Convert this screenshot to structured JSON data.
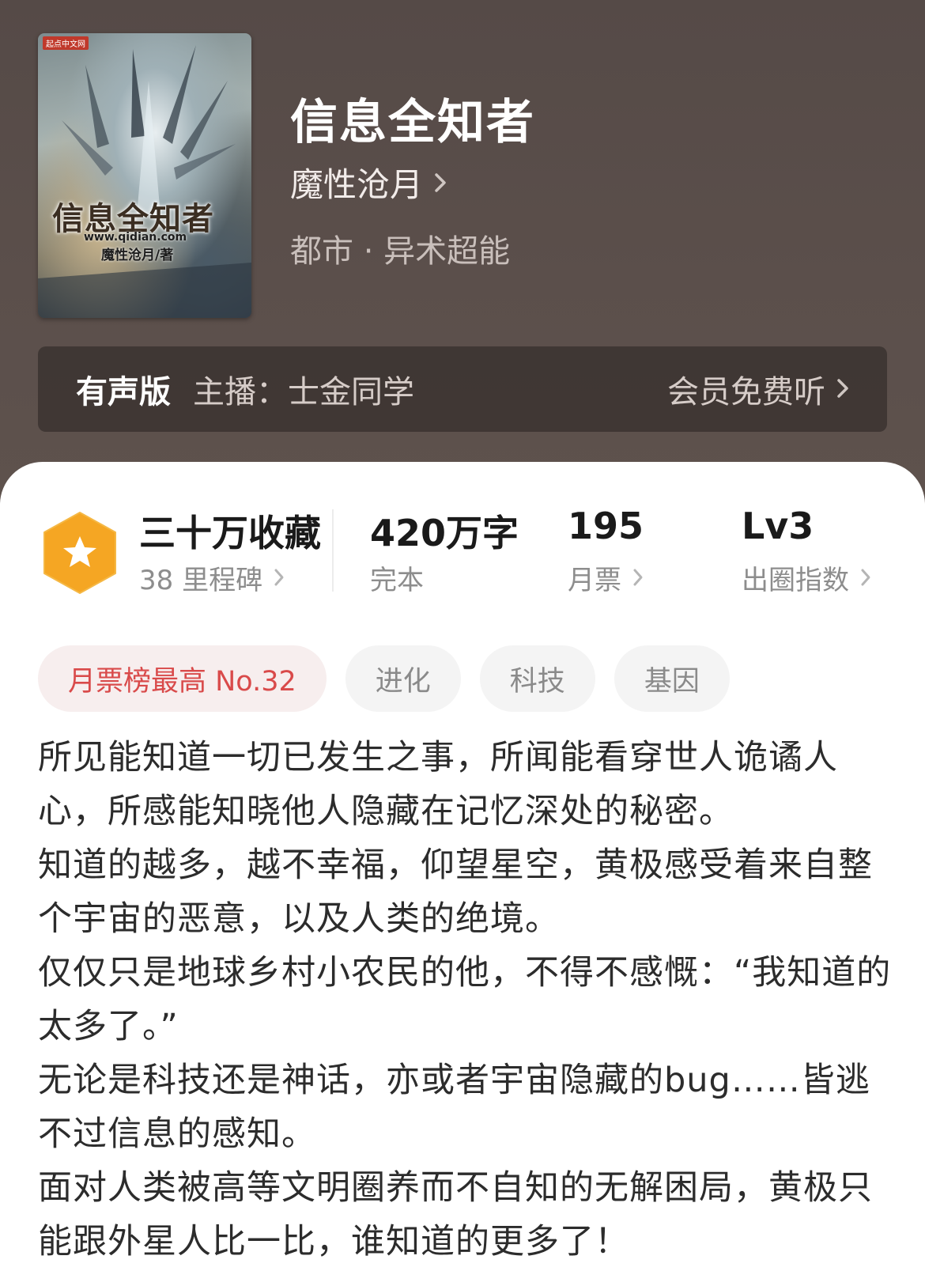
{
  "book": {
    "title": "信息全知者",
    "author": "魔性沧月",
    "genre": "都市 · 异术超能",
    "cover": {
      "publisher": "起点中文网",
      "title": "信息全知者",
      "url": "www.qidian.com",
      "author": "魔性沧月/著"
    }
  },
  "audio": {
    "tag": "有声版",
    "host": "主播：士金同学",
    "cta": "会员免费听"
  },
  "stats": {
    "collections": "三十万收藏",
    "milestones": "38 里程碑",
    "words": "420万字",
    "status": "完本",
    "tickets": "195",
    "tickets_label": "月票",
    "level": "Lv3",
    "level_label": "出圈指数"
  },
  "tags": [
    {
      "label": "月票榜最高 No.32"
    },
    {
      "label": "进化"
    },
    {
      "label": "科技"
    },
    {
      "label": "基因"
    }
  ],
  "description": [
    "所见能知道一切已发生之事，所闻能看穿世人诡谲人心，所感能知晓他人隐藏在记忆深处的秘密。",
    "知道的越多，越不幸福，仰望星空，黄极感受着来自整个宇宙的恶意，以及人类的绝境。",
    "仅仅只是地球乡村小农民的他，不得不感慨：“我知道的太多了。”",
    "无论是科技还是神话，亦或者宇宙隐藏的bug……皆逃不过信息的感知。",
    "面对人类被高等文明圈养而不自知的无解困局，黄极只能跟外星人比一比，谁知道的更多了！"
  ],
  "colors": {
    "hero_bg": "#5a4f4b",
    "accent_red": "#d94a4a",
    "badge_orange": "#f5a623"
  },
  "icons": [
    "chevron-right-icon",
    "star-hexagon-icon"
  ]
}
